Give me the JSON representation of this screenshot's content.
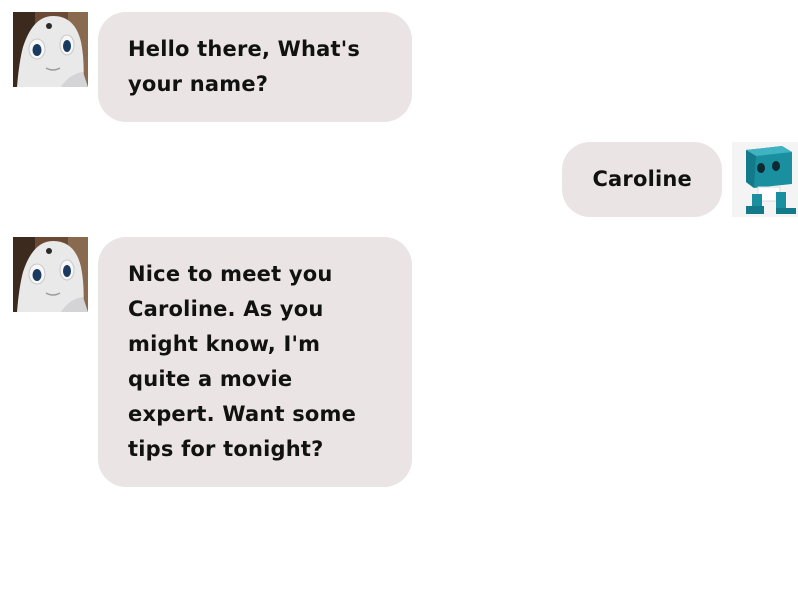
{
  "colors": {
    "bubble_bg": "#eae4e4",
    "text": "#111111",
    "robot_face": "#e8e8e8",
    "robot_eye": "#1a3a60",
    "cube_robot": "#1a8fa0"
  },
  "icons": {
    "bot_avatar": "humanoid-robot-face-icon",
    "user_avatar": "cube-robot-icon"
  },
  "messages": [
    {
      "sender": "bot",
      "text": "Hello there, What's your name?"
    },
    {
      "sender": "user",
      "text": "Caroline"
    },
    {
      "sender": "bot",
      "text": "Nice to meet you Caroline. As you might know, I'm quite a movie expert. Want some tips for tonight?"
    }
  ]
}
